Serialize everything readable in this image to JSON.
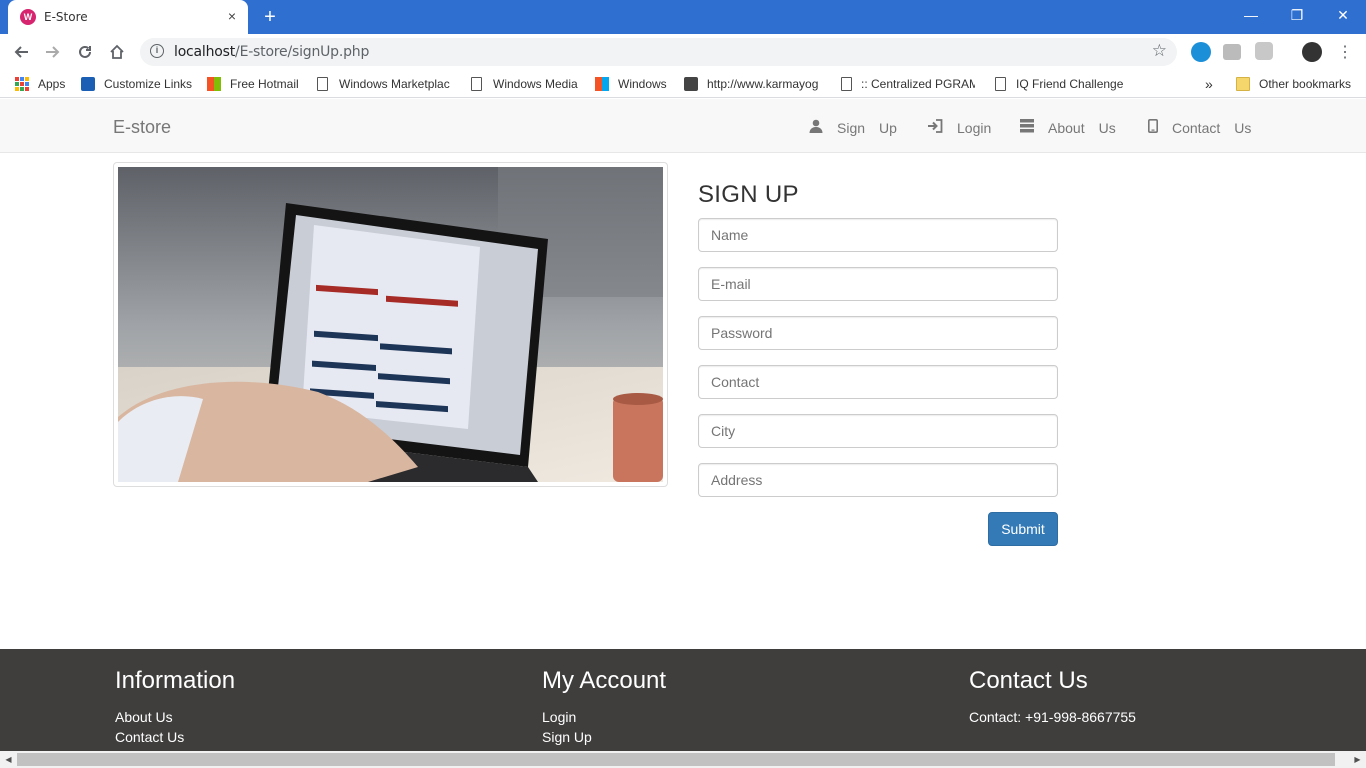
{
  "browser": {
    "tab_title": "E-Store",
    "tab_favicon_letter": "W",
    "new_tab": "+",
    "url_host": "localhost",
    "url_path": "/E-store/signUp.php",
    "window_controls": {
      "minimize": "—",
      "restore": "❐",
      "close": "✕"
    }
  },
  "bookmarks": {
    "items": [
      {
        "label": "Apps",
        "icon": "apps-grid-icon"
      },
      {
        "label": "Customize Links",
        "icon": "windows-live-icon"
      },
      {
        "label": "Free Hotmail",
        "icon": "windows-flag-icon"
      },
      {
        "label": "Windows Marketplac",
        "icon": "page-icon"
      },
      {
        "label": "Windows Media",
        "icon": "page-icon"
      },
      {
        "label": "Windows",
        "icon": "windows-flag-icon"
      },
      {
        "label": "http://www.karmayog",
        "icon": "site-icon"
      },
      {
        "label": ":: Centralized PGRAM",
        "icon": "page-icon"
      },
      {
        "label": "IQ Friend Challenge",
        "icon": "page-icon"
      }
    ],
    "overflow": "»",
    "other": "Other bookmarks"
  },
  "navbar": {
    "brand": "E-store",
    "links": [
      {
        "w1": "Sign",
        "w2": "Up",
        "icon": "user-icon"
      },
      {
        "w1": "Login",
        "w2": "",
        "icon": "login-icon"
      },
      {
        "w1": "About",
        "w2": "Us",
        "icon": "tasks-icon"
      },
      {
        "w1": "Contact",
        "w2": "Us",
        "icon": "phone-icon"
      }
    ]
  },
  "form": {
    "title": "SIGN UP",
    "placeholders": {
      "name": "Name",
      "email": "E-mail",
      "password": "Password",
      "contact": "Contact",
      "city": "City",
      "address": "Address"
    },
    "submit": "Submit"
  },
  "footer": {
    "information": {
      "heading": "Information",
      "links": [
        "About Us",
        "Contact Us"
      ]
    },
    "account": {
      "heading": "My Account",
      "links": [
        "Login",
        "Sign Up"
      ]
    },
    "contact": {
      "heading": "Contact Us",
      "line": "Contact: +91-998-8667755"
    }
  },
  "colors": {
    "chrome_blue": "#2f6fd0",
    "submit_blue": "#337ab7",
    "footer_bg": "#3f3e3d",
    "navbar_bg": "#f8f8f8"
  }
}
